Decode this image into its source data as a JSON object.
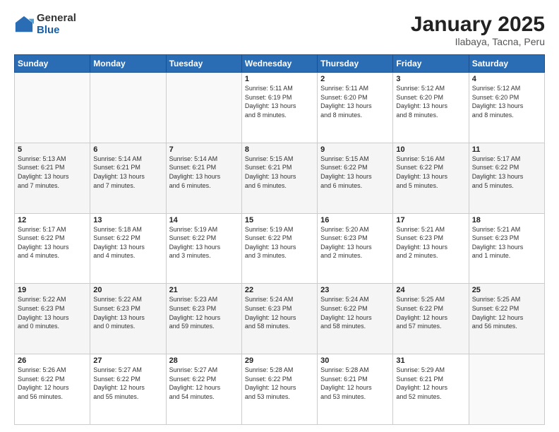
{
  "logo": {
    "general": "General",
    "blue": "Blue"
  },
  "title": "January 2025",
  "subtitle": "Ilabaya, Tacna, Peru",
  "header_days": [
    "Sunday",
    "Monday",
    "Tuesday",
    "Wednesday",
    "Thursday",
    "Friday",
    "Saturday"
  ],
  "weeks": [
    [
      {
        "num": "",
        "info": ""
      },
      {
        "num": "",
        "info": ""
      },
      {
        "num": "",
        "info": ""
      },
      {
        "num": "1",
        "info": "Sunrise: 5:11 AM\nSunset: 6:19 PM\nDaylight: 13 hours\nand 8 minutes."
      },
      {
        "num": "2",
        "info": "Sunrise: 5:11 AM\nSunset: 6:20 PM\nDaylight: 13 hours\nand 8 minutes."
      },
      {
        "num": "3",
        "info": "Sunrise: 5:12 AM\nSunset: 6:20 PM\nDaylight: 13 hours\nand 8 minutes."
      },
      {
        "num": "4",
        "info": "Sunrise: 5:12 AM\nSunset: 6:20 PM\nDaylight: 13 hours\nand 8 minutes."
      }
    ],
    [
      {
        "num": "5",
        "info": "Sunrise: 5:13 AM\nSunset: 6:21 PM\nDaylight: 13 hours\nand 7 minutes."
      },
      {
        "num": "6",
        "info": "Sunrise: 5:14 AM\nSunset: 6:21 PM\nDaylight: 13 hours\nand 7 minutes."
      },
      {
        "num": "7",
        "info": "Sunrise: 5:14 AM\nSunset: 6:21 PM\nDaylight: 13 hours\nand 6 minutes."
      },
      {
        "num": "8",
        "info": "Sunrise: 5:15 AM\nSunset: 6:21 PM\nDaylight: 13 hours\nand 6 minutes."
      },
      {
        "num": "9",
        "info": "Sunrise: 5:15 AM\nSunset: 6:22 PM\nDaylight: 13 hours\nand 6 minutes."
      },
      {
        "num": "10",
        "info": "Sunrise: 5:16 AM\nSunset: 6:22 PM\nDaylight: 13 hours\nand 5 minutes."
      },
      {
        "num": "11",
        "info": "Sunrise: 5:17 AM\nSunset: 6:22 PM\nDaylight: 13 hours\nand 5 minutes."
      }
    ],
    [
      {
        "num": "12",
        "info": "Sunrise: 5:17 AM\nSunset: 6:22 PM\nDaylight: 13 hours\nand 4 minutes."
      },
      {
        "num": "13",
        "info": "Sunrise: 5:18 AM\nSunset: 6:22 PM\nDaylight: 13 hours\nand 4 minutes."
      },
      {
        "num": "14",
        "info": "Sunrise: 5:19 AM\nSunset: 6:22 PM\nDaylight: 13 hours\nand 3 minutes."
      },
      {
        "num": "15",
        "info": "Sunrise: 5:19 AM\nSunset: 6:22 PM\nDaylight: 13 hours\nand 3 minutes."
      },
      {
        "num": "16",
        "info": "Sunrise: 5:20 AM\nSunset: 6:23 PM\nDaylight: 13 hours\nand 2 minutes."
      },
      {
        "num": "17",
        "info": "Sunrise: 5:21 AM\nSunset: 6:23 PM\nDaylight: 13 hours\nand 2 minutes."
      },
      {
        "num": "18",
        "info": "Sunrise: 5:21 AM\nSunset: 6:23 PM\nDaylight: 13 hours\nand 1 minute."
      }
    ],
    [
      {
        "num": "19",
        "info": "Sunrise: 5:22 AM\nSunset: 6:23 PM\nDaylight: 13 hours\nand 0 minutes."
      },
      {
        "num": "20",
        "info": "Sunrise: 5:22 AM\nSunset: 6:23 PM\nDaylight: 13 hours\nand 0 minutes."
      },
      {
        "num": "21",
        "info": "Sunrise: 5:23 AM\nSunset: 6:23 PM\nDaylight: 12 hours\nand 59 minutes."
      },
      {
        "num": "22",
        "info": "Sunrise: 5:24 AM\nSunset: 6:23 PM\nDaylight: 12 hours\nand 58 minutes."
      },
      {
        "num": "23",
        "info": "Sunrise: 5:24 AM\nSunset: 6:22 PM\nDaylight: 12 hours\nand 58 minutes."
      },
      {
        "num": "24",
        "info": "Sunrise: 5:25 AM\nSunset: 6:22 PM\nDaylight: 12 hours\nand 57 minutes."
      },
      {
        "num": "25",
        "info": "Sunrise: 5:25 AM\nSunset: 6:22 PM\nDaylight: 12 hours\nand 56 minutes."
      }
    ],
    [
      {
        "num": "26",
        "info": "Sunrise: 5:26 AM\nSunset: 6:22 PM\nDaylight: 12 hours\nand 56 minutes."
      },
      {
        "num": "27",
        "info": "Sunrise: 5:27 AM\nSunset: 6:22 PM\nDaylight: 12 hours\nand 55 minutes."
      },
      {
        "num": "28",
        "info": "Sunrise: 5:27 AM\nSunset: 6:22 PM\nDaylight: 12 hours\nand 54 minutes."
      },
      {
        "num": "29",
        "info": "Sunrise: 5:28 AM\nSunset: 6:22 PM\nDaylight: 12 hours\nand 53 minutes."
      },
      {
        "num": "30",
        "info": "Sunrise: 5:28 AM\nSunset: 6:21 PM\nDaylight: 12 hours\nand 53 minutes."
      },
      {
        "num": "31",
        "info": "Sunrise: 5:29 AM\nSunset: 6:21 PM\nDaylight: 12 hours\nand 52 minutes."
      },
      {
        "num": "",
        "info": ""
      }
    ]
  ]
}
